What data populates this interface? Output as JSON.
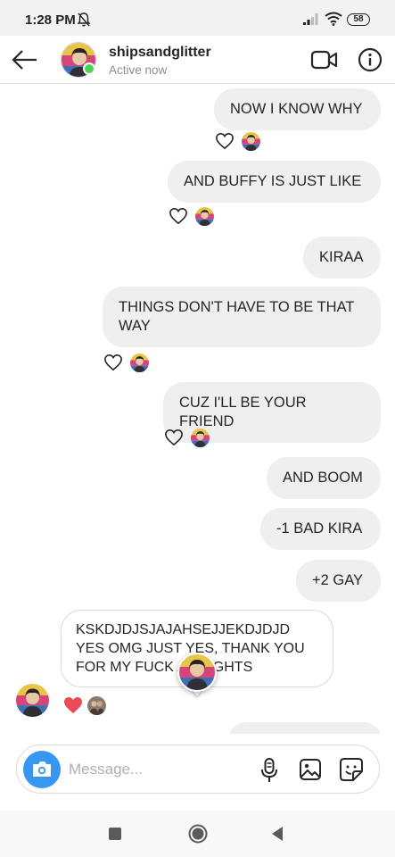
{
  "status_bar": {
    "time": "1:28 PM",
    "battery": "58"
  },
  "header": {
    "username": "shipsandglitter",
    "status": "Active now"
  },
  "messages": [
    {
      "text": "NOW I KNOW WHY"
    },
    {
      "text": "AND BUFFY IS JUST LIKE"
    },
    {
      "text": "KIRAA"
    },
    {
      "text": "THINGS DON'T HAVE TO BE THAT WAY"
    },
    {
      "text": "CUZ I'LL BE YOUR FRIEND"
    },
    {
      "text": "AND BOOM"
    },
    {
      "text": "-1 BAD KIRA"
    },
    {
      "text": "+2 GAY"
    },
    {
      "text": "KSKDJDJSJAJAHSEJJEKDJDJD YES OMG JUST YES, THANK YOU FOR MY FUCK   AY RIGHTS"
    }
  ],
  "composer": {
    "placeholder": "Message..."
  },
  "colors": {
    "accent": "#3797f0",
    "bubble": "#efefef",
    "online": "#4ed157",
    "heart_liked": "#ed4956"
  },
  "icons": [
    "back-arrow-icon",
    "video-call-icon",
    "info-icon",
    "heart-icon",
    "camera-icon",
    "microphone-icon",
    "gallery-icon",
    "sticker-icon",
    "recents-icon",
    "home-icon",
    "back-icon"
  ]
}
